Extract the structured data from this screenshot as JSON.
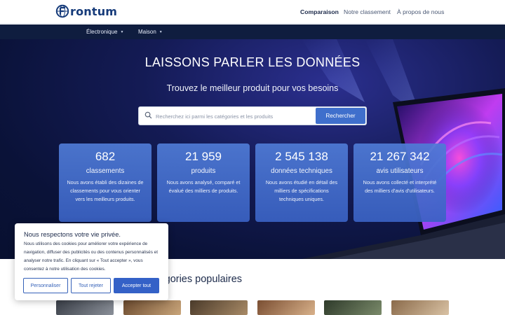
{
  "header": {
    "logo_text": "rontum",
    "logo_icon": "globe-f-icon",
    "nav": [
      "Comparaison",
      "Notre classement",
      "À propos de nous"
    ]
  },
  "categories": [
    "Électronique",
    "Maison"
  ],
  "hero": {
    "title": "LAISSONS PARLER LES DONNÉES",
    "subtitle": "Trouvez le meilleur produit pour vos besoins",
    "search": {
      "placeholder": "Recherchez ici parmi les catégories et les produits",
      "value": "",
      "button": "Rechercher"
    },
    "stats": [
      {
        "number": "682",
        "label": "classements",
        "desc": "Nous avons établi des dizaines de classements pour vous orienter vers les meilleurs produits."
      },
      {
        "number": "21 959",
        "label": "produits",
        "desc": "Nous avons analysé, comparé et évalué des milliers de produits."
      },
      {
        "number": "2 545 138",
        "label": "données techniques",
        "desc": "Nous avons étudié en détail des milliers de spécifications techniques uniques."
      },
      {
        "number": "21 267 342",
        "label": "avis utilisateurs",
        "desc": "Nous avons collecté et interprété des milliers d'avis d'utilisateurs."
      }
    ]
  },
  "popular": {
    "title": "Catégories populaires"
  },
  "cookie": {
    "title": "Nous respectons votre vie privée.",
    "text": "Nous utilisons des cookies pour améliorer votre expérience de navigation, diffuser des publicités ou des contenus personnalisés et analyser notre trafic. En cliquant sur « Tout accepter », vous consentez à notre utilisation des cookies.",
    "buttons": [
      "Personnaliser",
      "Tout rejeter",
      "Accepter tout"
    ]
  },
  "colors": {
    "brand": "#163b7a",
    "accent": "#3f6fcc",
    "hero_bg": "#0a1238",
    "stat_card": "#4f7bd6"
  }
}
